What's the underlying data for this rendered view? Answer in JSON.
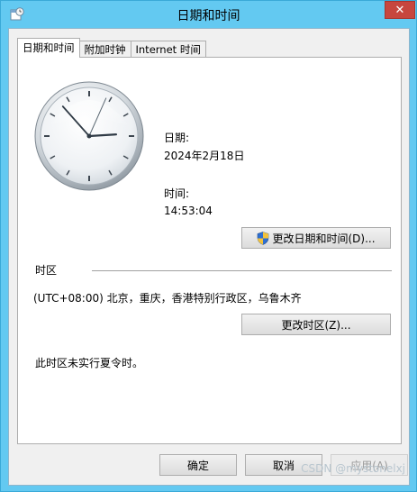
{
  "window": {
    "title": "日期和时间",
    "close_label": "✕"
  },
  "tabs": [
    {
      "label": "日期和时间",
      "active": true
    },
    {
      "label": "附加时钟",
      "active": false
    },
    {
      "label": "Internet 时间",
      "active": false
    }
  ],
  "date_time": {
    "date_label": "日期:",
    "date_value": "2024年2月18日",
    "time_label": "时间:",
    "time_value": "14:53:04",
    "change_button": "更改日期和时间(D)..."
  },
  "clock": {
    "hour": 14,
    "minute": 53,
    "second": 4
  },
  "timezone": {
    "section_label": "时区",
    "value": "(UTC+08:00) 北京，重庆，香港特别行政区，乌鲁木齐",
    "change_button": "更改时区(Z)...",
    "dst_note": "此时区未实行夏令时。"
  },
  "footer": {
    "ok_label": "确定",
    "cancel_label": "取消",
    "apply_label": "应用(A)"
  },
  "watermark": "CSDN @mystonelxj"
}
